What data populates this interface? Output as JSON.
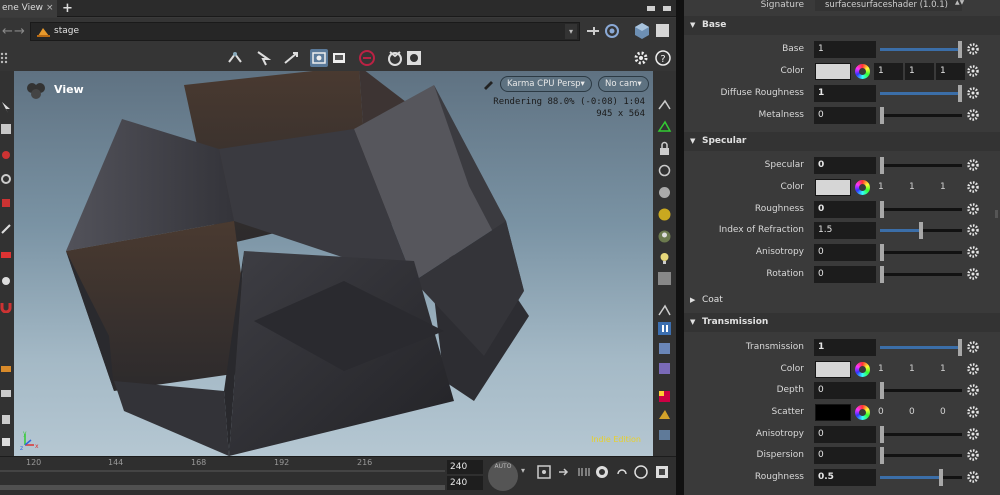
{
  "tabs": {
    "scene_tab_label": "ene View",
    "close_glyph": "×",
    "add_glyph": "+"
  },
  "pathbar": {
    "back_glyph": "←",
    "forward_glyph": "→",
    "context_label": "stage",
    "dropdown_glyph": "▾"
  },
  "viewport": {
    "title": "View",
    "renderer_label": "Karma CPU  Persp▾",
    "camera_label": "No cam▾",
    "render_status": "Rendering  88.0%  (-0:08)  1:04",
    "resolution": "945 x 564",
    "edition_label": "Indie Edition",
    "axis_labels": {
      "x": "x",
      "y": "y",
      "z": "z"
    }
  },
  "timeline": {
    "tick_labels": [
      "120",
      "144",
      "168",
      "192",
      "216"
    ],
    "start_frame": "240",
    "end_frame": "240",
    "auto_label": "AUTO"
  },
  "params": {
    "signature": {
      "label": "Signature",
      "value": "surfacesurfaceshader (1.0.1)",
      "spinner": "▲▼"
    },
    "sections": {
      "base": "Base",
      "specular": "Specular",
      "coat": "Coat",
      "transmission": "Transmission"
    },
    "base": {
      "base": {
        "label": "Base",
        "value": "1",
        "level": 1.0
      },
      "color": {
        "label": "Color",
        "r": "1",
        "g": "1",
        "b": "1",
        "swatch": "#d6d6d6"
      },
      "diffuse_roughness": {
        "label": "Diffuse Roughness",
        "value": "1",
        "level": 1.0
      },
      "metalness": {
        "label": "Metalness",
        "value": "0",
        "level": 0.0
      }
    },
    "specular": {
      "specular": {
        "label": "Specular",
        "value": "0",
        "level": 0.0
      },
      "color": {
        "label": "Color",
        "r": "1",
        "g": "1",
        "b": "1",
        "swatch": "#d6d6d6"
      },
      "roughness": {
        "label": "Roughness",
        "value": "0",
        "level": 0.0
      },
      "ior": {
        "label": "Index of Refraction",
        "value": "1.5",
        "level": 0.5
      },
      "anisotropy": {
        "label": "Anisotropy",
        "value": "0",
        "level": 0.0
      },
      "rotation": {
        "label": "Rotation",
        "value": "0",
        "level": 0.0
      }
    },
    "transmission": {
      "transmission": {
        "label": "Transmission",
        "value": "1",
        "level": 1.0
      },
      "color": {
        "label": "Color",
        "r": "1",
        "g": "1",
        "b": "1",
        "swatch": "#d6d6d6"
      },
      "depth": {
        "label": "Depth",
        "value": "0",
        "level": 0.0
      },
      "scatter": {
        "label": "Scatter",
        "r": "0",
        "g": "0",
        "b": "0",
        "swatch": "#000000"
      },
      "anisotropy": {
        "label": "Anisotropy",
        "value": "0",
        "level": 0.0
      },
      "dispersion": {
        "label": "Dispersion",
        "value": "0",
        "level": 0.0
      },
      "roughness": {
        "label": "Roughness",
        "value": "0.5",
        "level": 0.75
      }
    }
  },
  "colors": {
    "accent_blue": "#3b6ea8",
    "edition_yellow": "#e8d12a"
  }
}
